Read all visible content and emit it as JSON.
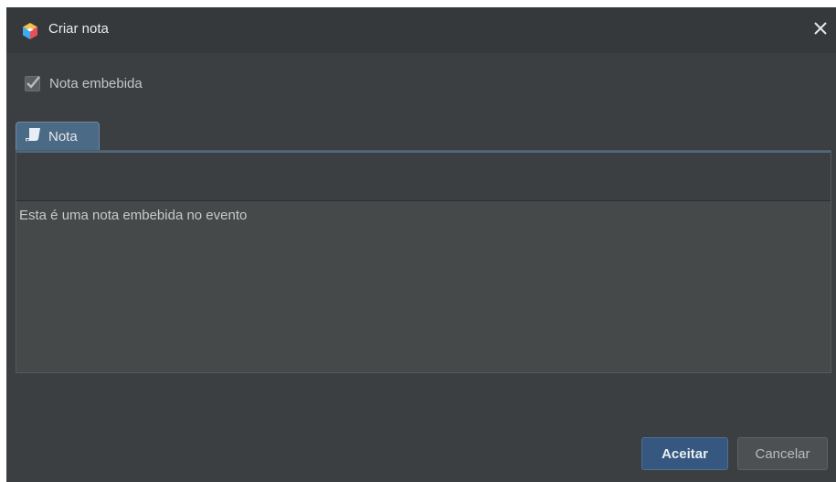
{
  "window": {
    "title": "Criar nota",
    "app_icon": "app-cube-icon",
    "close_icon": "close-icon"
  },
  "options": {
    "embedded_checkbox_label": "Nota embebida",
    "embedded_checked": true
  },
  "tabs": [
    {
      "label": "Nota",
      "icon": "note-icon",
      "active": true
    }
  ],
  "note": {
    "text": "Esta é uma nota embebida no evento"
  },
  "buttons": {
    "accept_label": "Aceitar",
    "cancel_label": "Cancelar"
  },
  "colors": {
    "window_bg": "#3c3f41",
    "titlebar_bg": "#36393b",
    "tab_active": "#4b6a86",
    "accept_bg": "#365880",
    "text_area_bg": "#45494a"
  }
}
